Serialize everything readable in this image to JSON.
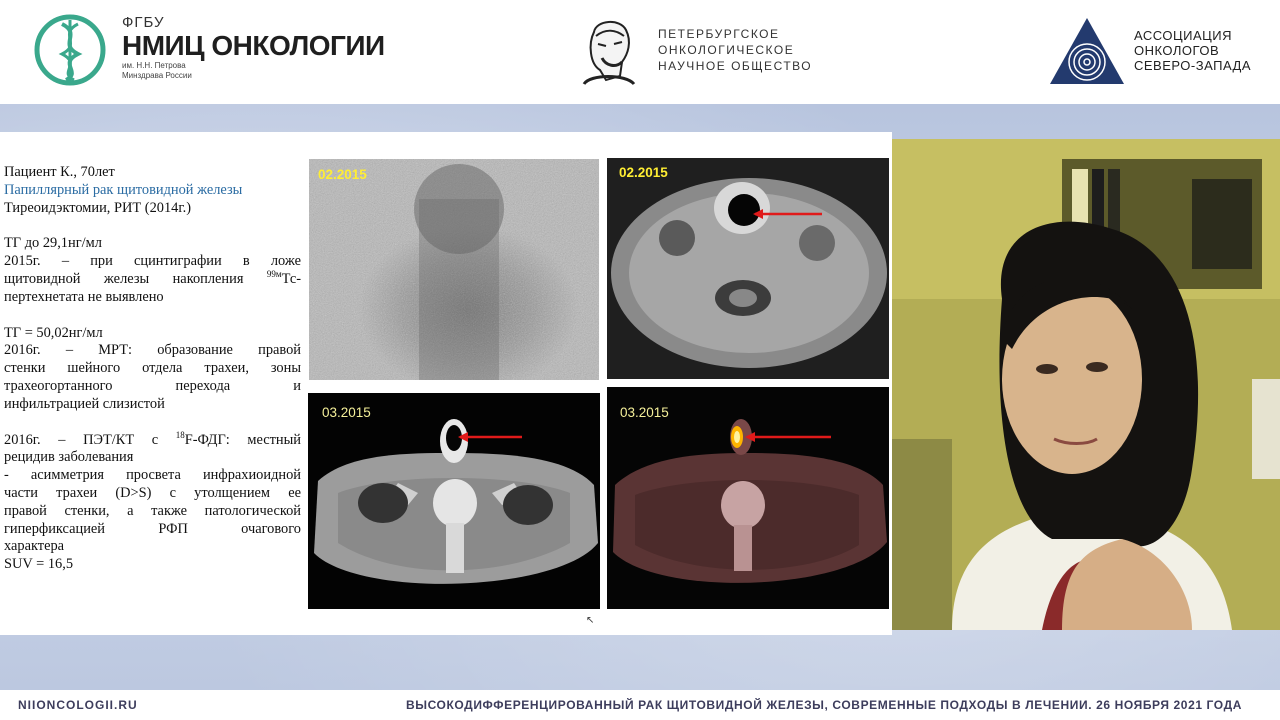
{
  "header": {
    "logo1": {
      "small": "ФГБУ",
      "big": "НМИЦ ОНКОЛОГИИ",
      "sub_line1": "им. Н.Н. Петрова",
      "sub_line2": "Минздрава России",
      "icon": "dna-caduceus-icon"
    },
    "logo2": {
      "line1": "ПЕТЕРБУРГСКОЕ",
      "line2": "ОНКОЛОГИЧЕСКОЕ",
      "line3": "НАУЧНОЕ ОБЩЕСТВО",
      "icon": "portrait-engraving-icon"
    },
    "logo3": {
      "line1": "АССОЦИАЦИЯ",
      "line2": "ОНКОЛОГОВ",
      "line3": "СЕВЕРО-ЗАПАДА",
      "icon": "triangle-logo-icon"
    }
  },
  "slide": {
    "patient": "Пациент К., 70лет",
    "diagnosis": "Папиллярный рак щитовидной железы",
    "treatment": "Тиреоидэктомии, РИТ (2014г.)",
    "tg1": "ТГ до 29,1нг/мл",
    "scint_p1": "2015г. – при сцинтиграфии в ложе",
    "scint_p2a": "щитовидной железы накопления ",
    "scint_sup": "99м",
    "scint_p2b": "Тс-",
    "scint_p3": "пертехнетата не выявлено",
    "tg2": "ТГ = 50,02нг/мл",
    "mri_p1": "2016г. – МРТ: образование правой",
    "mri_p2": "стенки шейного отдела трахеи, зоны",
    "mri_p3": "трахеогортанного перехода и",
    "mri_p4": "инфильтрацией слизистой",
    "pet_p1a": "2016г. – ПЭТ/КТ с ",
    "pet_sup": "18",
    "pet_p1b": "F-ФДГ: местный",
    "pet_p2": "рецидив заболевания",
    "pet_p3": "- асимметрия просвета инфрахиоидной",
    "pet_p4": "части трахеи (D>S) с утолщением ее",
    "pet_p5": "правой стенки, а также патологической",
    "pet_p6": "гиперфиксацией РФП очагового",
    "pet_p7": "характера",
    "suv": "SUV = 16,5",
    "images": {
      "scint_label": "02.2015",
      "mri_label": "02.2015",
      "ct_label": "03.2015",
      "pet_label": "03.2015"
    },
    "arrow_color": "#e01a1a"
  },
  "footer": {
    "site": "NIIONCOLOGII.RU",
    "event": "ВЫСОКОДИФФЕРЕНЦИРОВАННЫЙ РАК ЩИТОВИДНОЙ ЖЕЛЕЗЫ, СОВРЕМЕННЫЕ ПОДХОДЫ В ЛЕЧЕНИИ. 26 НОЯБРЯ 2021 ГОДА"
  }
}
